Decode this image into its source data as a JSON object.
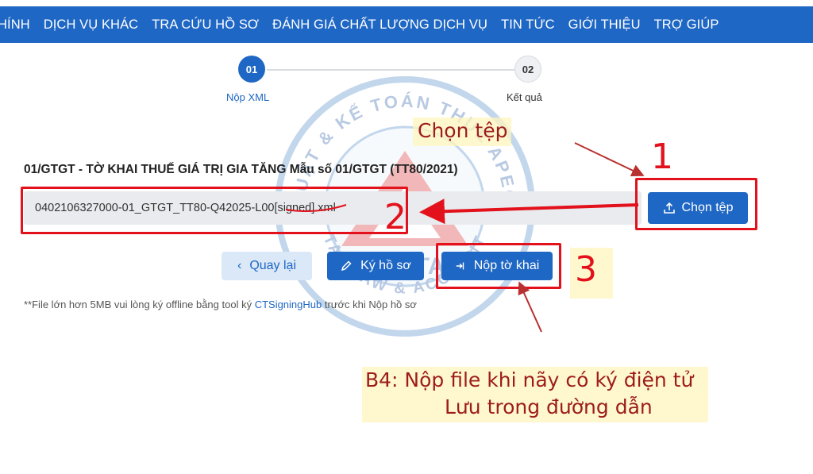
{
  "nav": {
    "items": [
      "HÍNH",
      "DỊCH VỤ KHÁC",
      "TRA CỨU HỒ SƠ",
      "ĐÁNH GIÁ CHẤT LƯỢNG DỊCH VỤ",
      "TIN TỨC",
      "GIỚI THIỆU",
      "TRỢ GIÚP"
    ]
  },
  "stepper": {
    "steps": [
      {
        "number": "01",
        "label": "Nộp XML"
      },
      {
        "number": "02",
        "label": "Kết quả"
      }
    ]
  },
  "watermark": {
    "top_text": "LUẬT & KẾ TOÁN THUẾ APEC",
    "brand": "APECTAX",
    "bottom_text": "TAX LAW & ACCOUNT"
  },
  "form": {
    "title": "01/GTGT - TỜ KHAI THUẾ GIÁ TRỊ GIA TĂNG Mẫu số 01/GTGT (TT80/2021)",
    "file_name": "0402106327000-01_GTGT_TT80-Q42025-L00[signed].xml",
    "choose_file_label": "Chọn tệp",
    "back_label": "Quay lại",
    "sign_label": "Ký hồ sơ",
    "submit_label": "Nộp tờ khai",
    "note_prefix": "**File lớn hơn 5MB vui lòng ký offline bằng tool ký ",
    "note_link": "CTSigningHub",
    "note_suffix": " trước khi Nộp hồ sơ"
  },
  "annotations": {
    "choose_file_caption": "Chọn tệp",
    "num_1": "1",
    "num_2": "2",
    "num_3": "3",
    "instruction_line1": "B4: Nộp file khi nãy có ký điện tử",
    "instruction_line2": "Lưu trong đường dẫn"
  },
  "colors": {
    "primary": "#1f67c4",
    "annotation_red": "#e3111b",
    "annotation_text": "#9c1c1c",
    "highlight": "#fff6be"
  }
}
